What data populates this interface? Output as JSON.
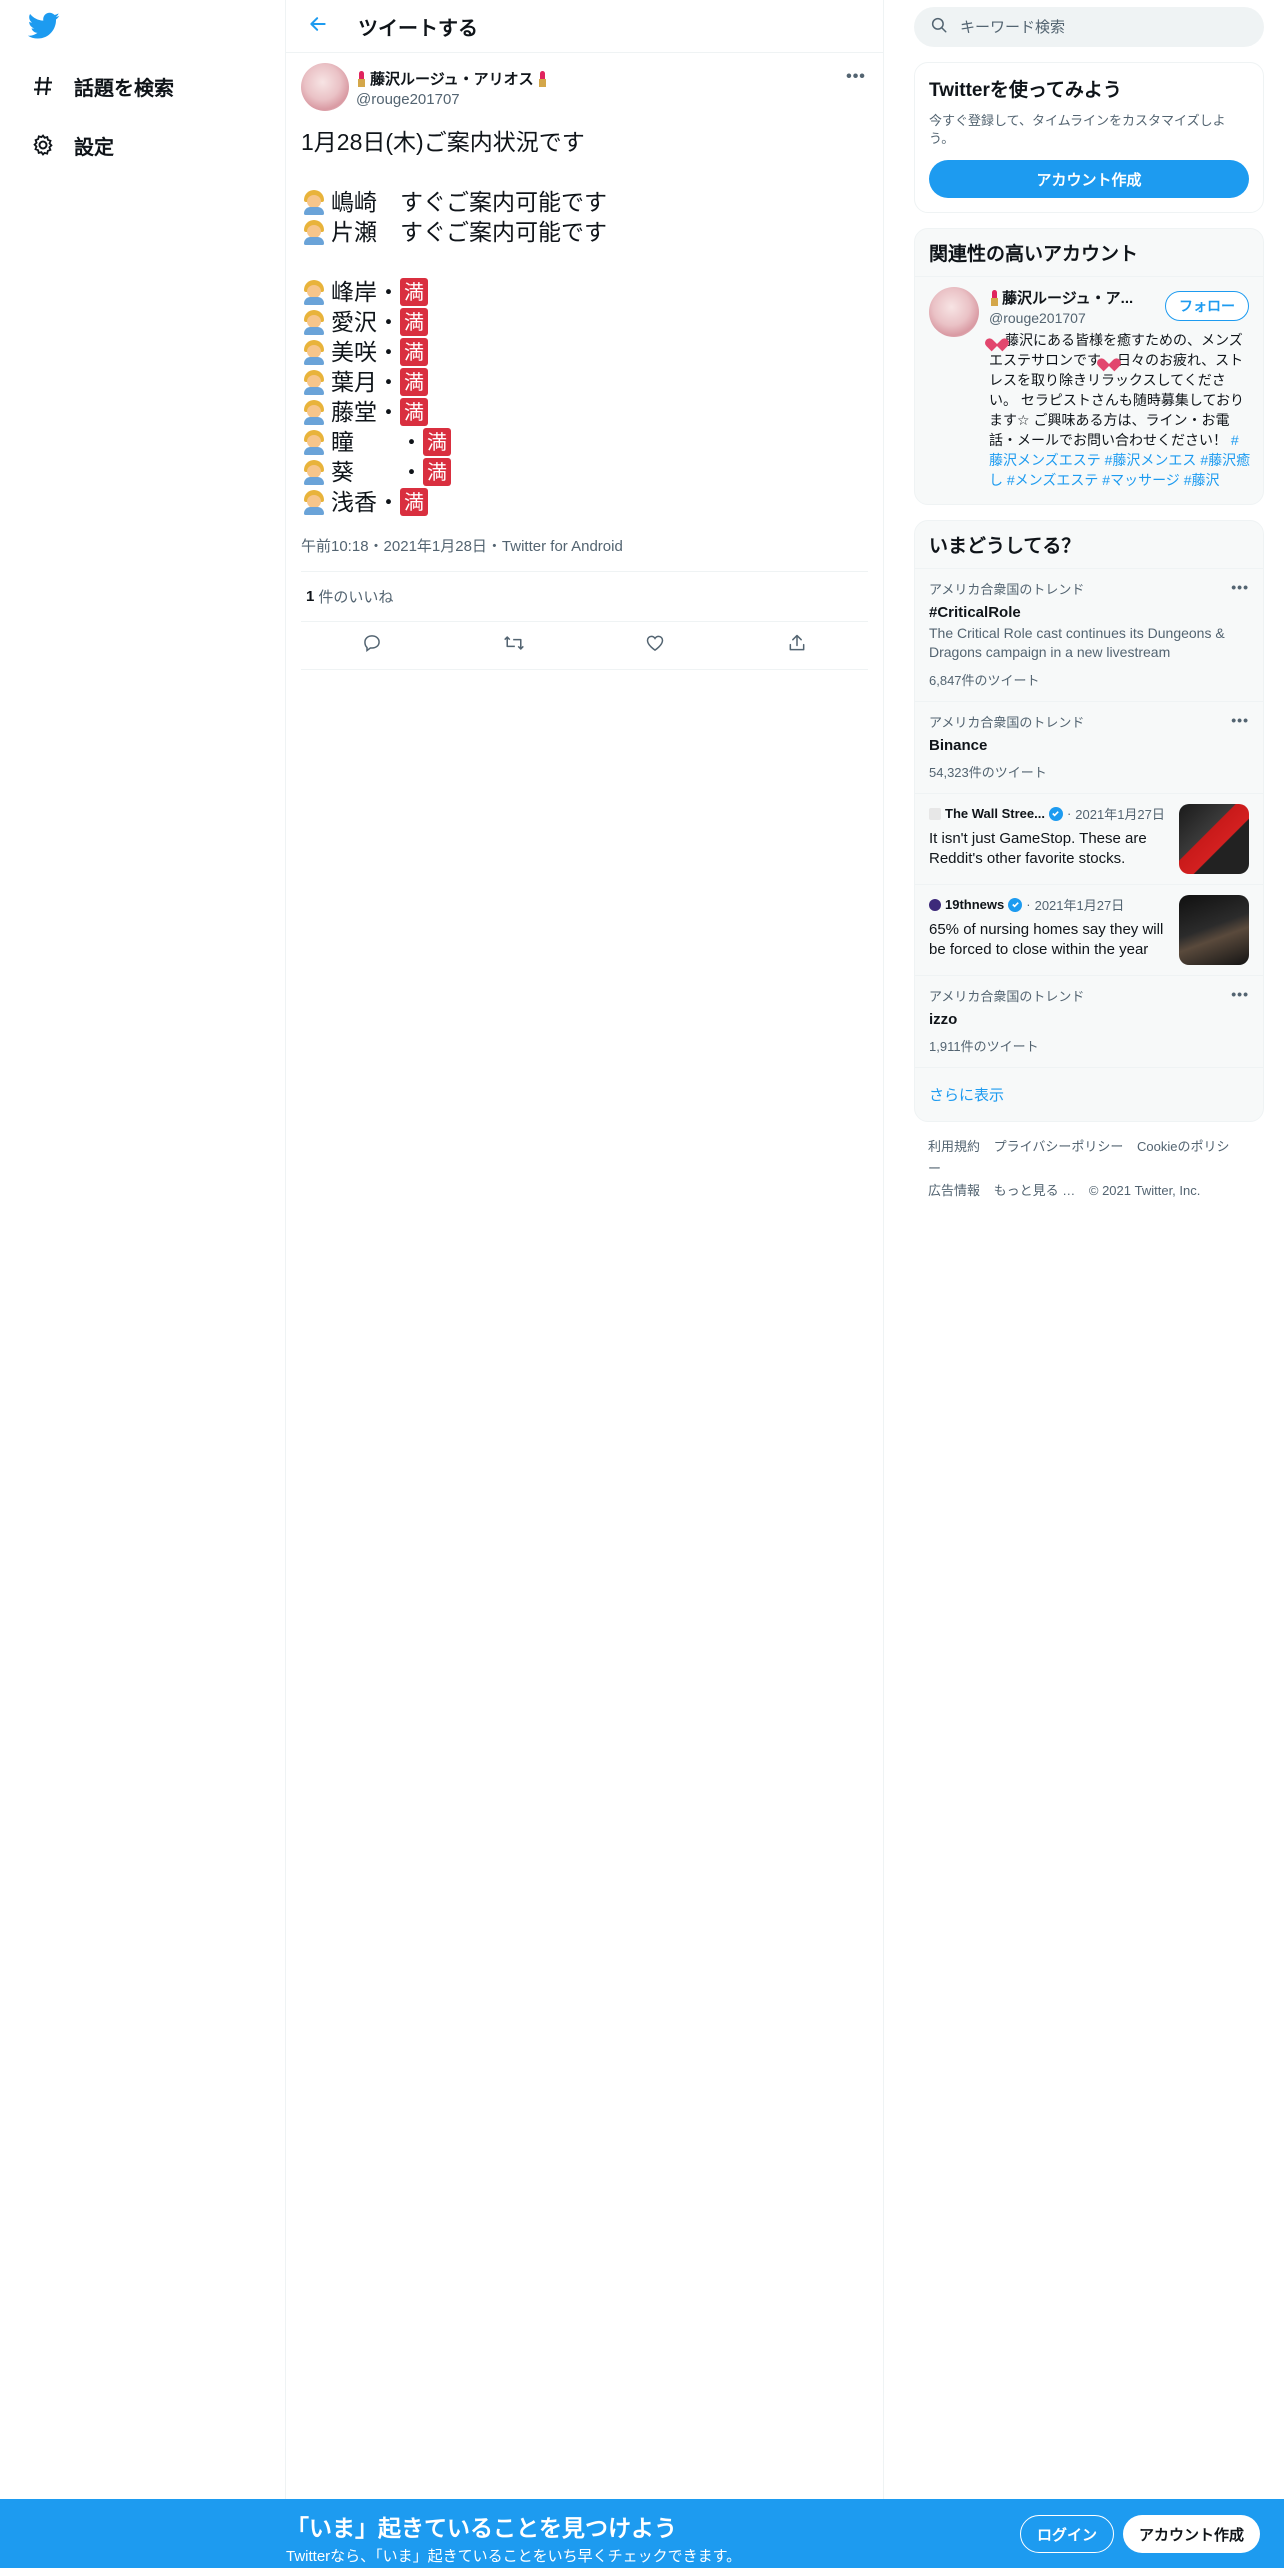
{
  "nav": {
    "logo_icon": "twitter-bird-icon",
    "items": [
      {
        "label": "話題を検索",
        "icon": "hashtag-icon"
      },
      {
        "label": "設定",
        "icon": "gear-icon"
      }
    ]
  },
  "header": {
    "title": "ツイートする",
    "back_icon": "arrow-left-icon"
  },
  "tweet": {
    "author_name": "藤沢ルージュ・アリオス",
    "author_handle": "@rouge201707",
    "lines": [
      {
        "text": "1月28日(木)ご案内状況です",
        "emoji": false,
        "badge": false
      },
      {
        "gap": true
      },
      {
        "text": "嶋崎　すぐご案内可能です",
        "emoji": true,
        "badge": false
      },
      {
        "text": "片瀬　すぐご案内可能です",
        "emoji": true,
        "badge": false
      },
      {
        "gap": true
      },
      {
        "text": "峰岸・",
        "emoji": true,
        "badge": true
      },
      {
        "text": "愛沢・",
        "emoji": true,
        "badge": true
      },
      {
        "text": "美咲・",
        "emoji": true,
        "badge": true
      },
      {
        "text": "葉月・",
        "emoji": true,
        "badge": true
      },
      {
        "text": "藤堂・",
        "emoji": true,
        "badge": true
      },
      {
        "text": "瞳　　・",
        "emoji": true,
        "badge": true
      },
      {
        "text": "葵　　・",
        "emoji": true,
        "badge": true
      },
      {
        "text": "浅香・",
        "emoji": true,
        "badge": true
      }
    ],
    "badge_label": "満",
    "meta": "午前10:18・2021年1月28日・Twitter for Android",
    "likes_count": "1",
    "likes_label": "件のいいね",
    "actions": [
      "reply-icon",
      "retweet-icon",
      "like-icon",
      "share-icon"
    ]
  },
  "search": {
    "placeholder": "キーワード検索"
  },
  "signup_card": {
    "title": "Twitterを使ってみよう",
    "desc": "今すぐ登録して、タイムラインをカスタマイズしよう。",
    "button": "アカウント作成"
  },
  "relevant": {
    "title": "関連性の高いアカウント",
    "name": "藤沢ルージュ・ア...",
    "handle": "@rouge201707",
    "follow": "フォロー",
    "bio_part1": "藤沢にある皆様を癒すための、メンズエステサロンです",
    "bio_part2": "日々のお疲れ、ストレスを取り除きリラックスしてください。 セラピストさんも随時募集しております☆ ご興味ある方は、ライン・お電話・メールでお問い合わせください！ ",
    "tags": [
      "#藤沢メンズエステ",
      "#藤沢メンエス",
      "#藤沢癒し",
      "#メンズエステ",
      "#マッサージ",
      "#藤沢"
    ]
  },
  "trends": {
    "title": "いまどうしてる？",
    "items": [
      {
        "context": "アメリカ合衆国のトレンド",
        "name": "#CriticalRole",
        "desc": "The Critical Role cast continues its Dungeons & Dragons campaign in a new livestream",
        "count": "6,847件のツイート"
      },
      {
        "context": "アメリカ合衆国のトレンド",
        "name": "Binance",
        "count": "54,323件のツイート"
      }
    ],
    "news": [
      {
        "source": "The Wall Stree...",
        "date": "2021年1月27日",
        "headline": "It isn't just GameStop. These are Reddit's other favorite stocks."
      },
      {
        "source": "19thnews",
        "date": "2021年1月27日",
        "headline": "65% of nursing homes say they will be forced to close within the year"
      }
    ],
    "last": {
      "context": "アメリカ合衆国のトレンド",
      "name": "izzo",
      "count": "1,911件のツイート"
    },
    "show_more": "さらに表示"
  },
  "footer": {
    "links": [
      "利用規約",
      "プライバシーポリシー",
      "Cookieのポリシー",
      "広告情報",
      "もっと見る …",
      "© 2021 Twitter, Inc."
    ]
  },
  "bottom_bar": {
    "title": "「いま」起きていることを見つけよう",
    "subtitle": "Twitterなら、「いま」起きていることをいち早くチェックできます。",
    "login": "ログイン",
    "signup": "アカウント作成"
  },
  "colors": {
    "accent": "#1d9bf0",
    "badge_red": "#d92f3f",
    "text": "#0f1419",
    "muted": "#536471"
  }
}
